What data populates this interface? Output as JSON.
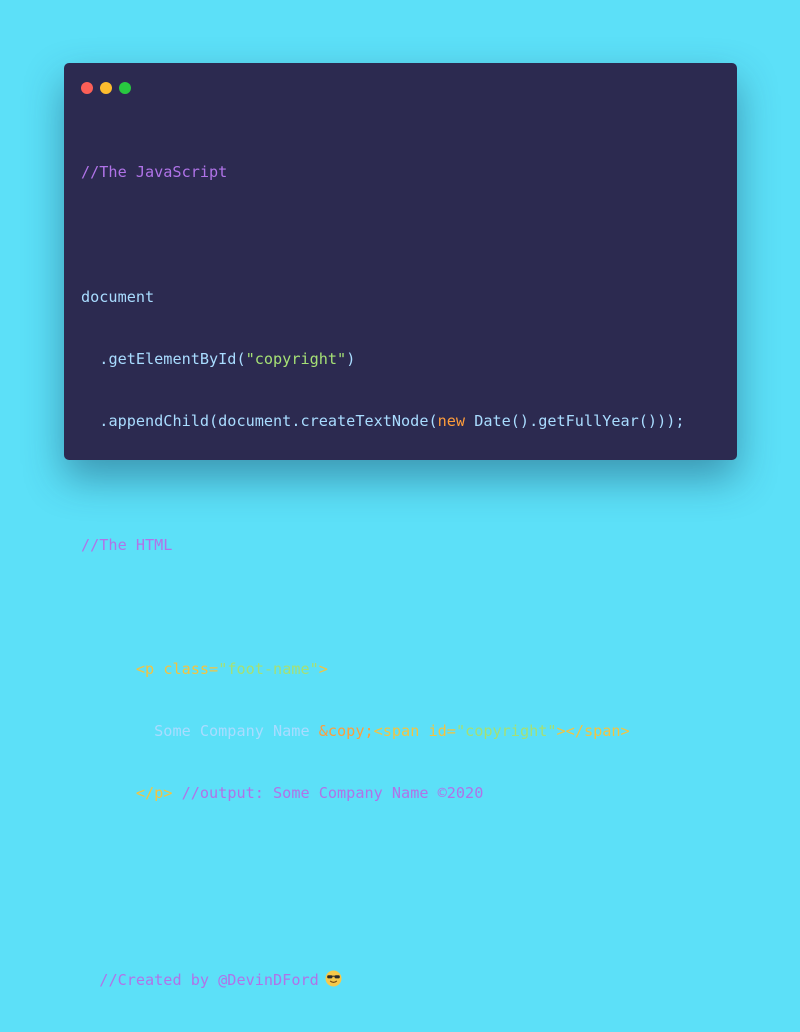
{
  "window": {
    "controls": [
      {
        "name": "close",
        "color": "#fc5f57"
      },
      {
        "name": "minimize",
        "color": "#fdbc2e"
      },
      {
        "name": "maximize",
        "color": "#28c840"
      }
    ]
  },
  "code": {
    "comment_js": "//The JavaScript",
    "line_document": "document",
    "line2_indent": "  ",
    "line2_method": ".getElementById(",
    "line2_string": "\"copyright\"",
    "line2_close": ")",
    "line3_indent": "  ",
    "line3_method": ".appendChild(document.createTextNode(",
    "line3_keyword": "new",
    "line3_rest": " Date().getFullYear()));",
    "comment_html": "//The HTML",
    "html1_indent": "      ",
    "html1_open": "<p ",
    "html1_attr": "class=",
    "html1_value": "\"foot-name\"",
    "html1_close": ">",
    "html2_indent": "        ",
    "html2_text": "Some Company Name ",
    "html2_entity": "&copy;",
    "html2_span_open": "<span ",
    "html2_span_attr": "id=",
    "html2_span_value": "\"copyright\"",
    "html2_span_close": "></span>",
    "html3_indent": "      ",
    "html3_close_tag": "</p>",
    "html3_comment": " //output: Some Company Name ©2020",
    "credit_indent": "  ",
    "credit": "//Created by @DevinDFord",
    "credit_emoji": "sunglasses-emoji"
  }
}
